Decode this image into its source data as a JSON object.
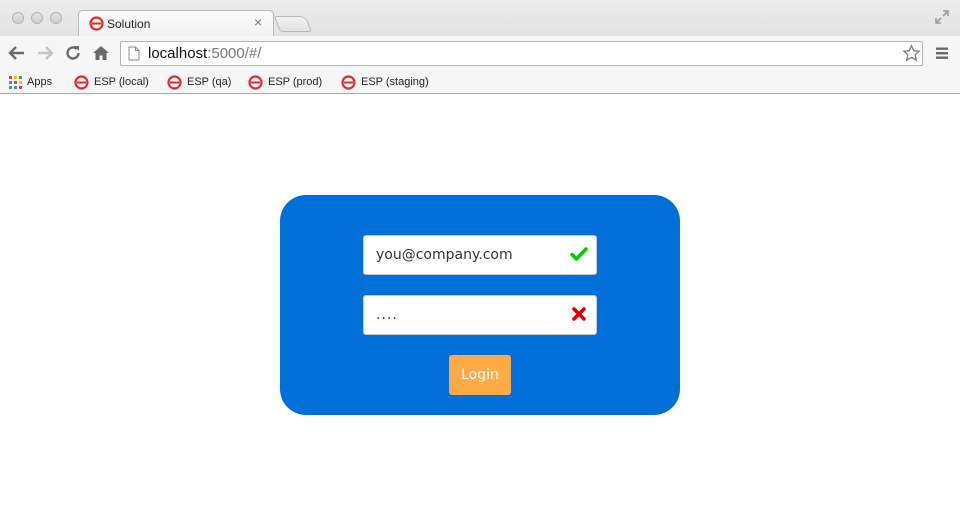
{
  "browser": {
    "tab": {
      "title": "Solution",
      "close_glyph": "×"
    },
    "address": {
      "host": "localhost",
      "rest": ":5000/#/"
    },
    "bookmarks": [
      {
        "label": "Apps",
        "icon": "apps-grid-icon"
      },
      {
        "label": "ESP (local)",
        "icon": "esp-logo-icon"
      },
      {
        "label": "ESP (qa)",
        "icon": "esp-logo-icon"
      },
      {
        "label": "ESP (prod)",
        "icon": "esp-logo-icon"
      },
      {
        "label": "ESP (staging)",
        "icon": "esp-logo-icon"
      }
    ]
  },
  "login": {
    "email": {
      "value": "you@company.com",
      "status": "valid"
    },
    "password": {
      "value": "....",
      "status": "invalid"
    },
    "submit_label": "Login"
  },
  "colors": {
    "card": "#006fd8",
    "button": "#fdaa47",
    "valid": "#00d000",
    "invalid": "#e00000",
    "esp_logo": "#e22b2b"
  }
}
